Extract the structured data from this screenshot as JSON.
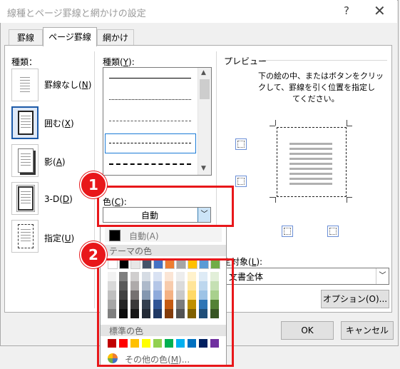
{
  "window": {
    "title": "線種とページ罫線と網かけの設定",
    "help_glyph": "?",
    "close_glyph": "✕"
  },
  "tabs": [
    {
      "label": "罫線",
      "active": false
    },
    {
      "label": "ページ罫線",
      "active": true
    },
    {
      "label": "網かけ",
      "active": false
    }
  ],
  "settings": {
    "label": "種類：",
    "items": [
      {
        "label": "罫線なし",
        "key": "N",
        "icon": "page-no-border-icon"
      },
      {
        "label": "囲む",
        "key": "X",
        "icon": "page-box-border-icon",
        "selected": true
      },
      {
        "label": "影",
        "key": "A",
        "icon": "page-shadow-border-icon"
      },
      {
        "label": "3-D",
        "key": "D",
        "icon": "page-3d-border-icon"
      },
      {
        "label": "指定",
        "key": "U",
        "icon": "page-custom-border-icon"
      }
    ]
  },
  "style": {
    "label": "種類(",
    "key": "Y",
    "suffix": "):",
    "line_styles": [
      "solid",
      "dotted",
      "dashed-small",
      "dashed",
      "dash-dot"
    ],
    "selected_index": 3
  },
  "color": {
    "label": "色(",
    "key": "C",
    "suffix": "):",
    "value": "自動"
  },
  "palette": {
    "automatic_label": "自動(A)",
    "theme_header": "テーマの色",
    "standard_header": "標準の色",
    "more_label": "その他の色(",
    "more_key": "M",
    "more_suffix": ")...",
    "theme_row": [
      "#ffffff",
      "#000000",
      "#e7e6e6",
      "#44546a",
      "#4472c4",
      "#ed7d31",
      "#a5a5a5",
      "#ffc000",
      "#5b9bd5",
      "#70ad47"
    ],
    "theme_shades": [
      [
        "#f2f2f2",
        "#d9d9d9",
        "#bfbfbf",
        "#a6a6a6",
        "#7f7f7f"
      ],
      [
        "#7f7f7f",
        "#595959",
        "#404040",
        "#262626",
        "#0d0d0d"
      ],
      [
        "#d0cece",
        "#aeaaaa",
        "#757171",
        "#3a3838",
        "#171616"
      ],
      [
        "#d6dce4",
        "#adb9ca",
        "#8497b0",
        "#333f4f",
        "#222a35"
      ],
      [
        "#d9e2f3",
        "#b4c6e7",
        "#8eaadb",
        "#2f5496",
        "#1f3864"
      ],
      [
        "#fbe5d5",
        "#f7cbac",
        "#f4b183",
        "#c55a11",
        "#833c0b"
      ],
      [
        "#ededed",
        "#dbdbdb",
        "#c9c9c9",
        "#7b7b7b",
        "#525252"
      ],
      [
        "#fff2cc",
        "#ffe599",
        "#ffd966",
        "#bf9000",
        "#7f6000"
      ],
      [
        "#deebf6",
        "#bdd7ee",
        "#9dc3e6",
        "#2e75b5",
        "#1f4e79"
      ],
      [
        "#e2efd9",
        "#c5e0b3",
        "#a8d08d",
        "#538135",
        "#375623"
      ]
    ],
    "standard_row": [
      "#c00000",
      "#ff0000",
      "#ffc000",
      "#ffff00",
      "#92d050",
      "#00b050",
      "#00b0f0",
      "#0070c0",
      "#002060",
      "#7030a0"
    ]
  },
  "preview": {
    "label": "プレビュー",
    "instructions": [
      "下の絵の中、またはボタンをクリッ",
      "クして、罫線を引く位置を指定し",
      "てください。"
    ]
  },
  "apply_to": {
    "label_visible": "設定対象(",
    "key": "L",
    "suffix": "):",
    "value": "文書全体"
  },
  "buttons": {
    "options": "オプション(O)...",
    "ok": "OK",
    "cancel": "キャンセル"
  },
  "annotations": {
    "badge1": "1",
    "badge2": "2",
    "accent": "#e8171a"
  }
}
